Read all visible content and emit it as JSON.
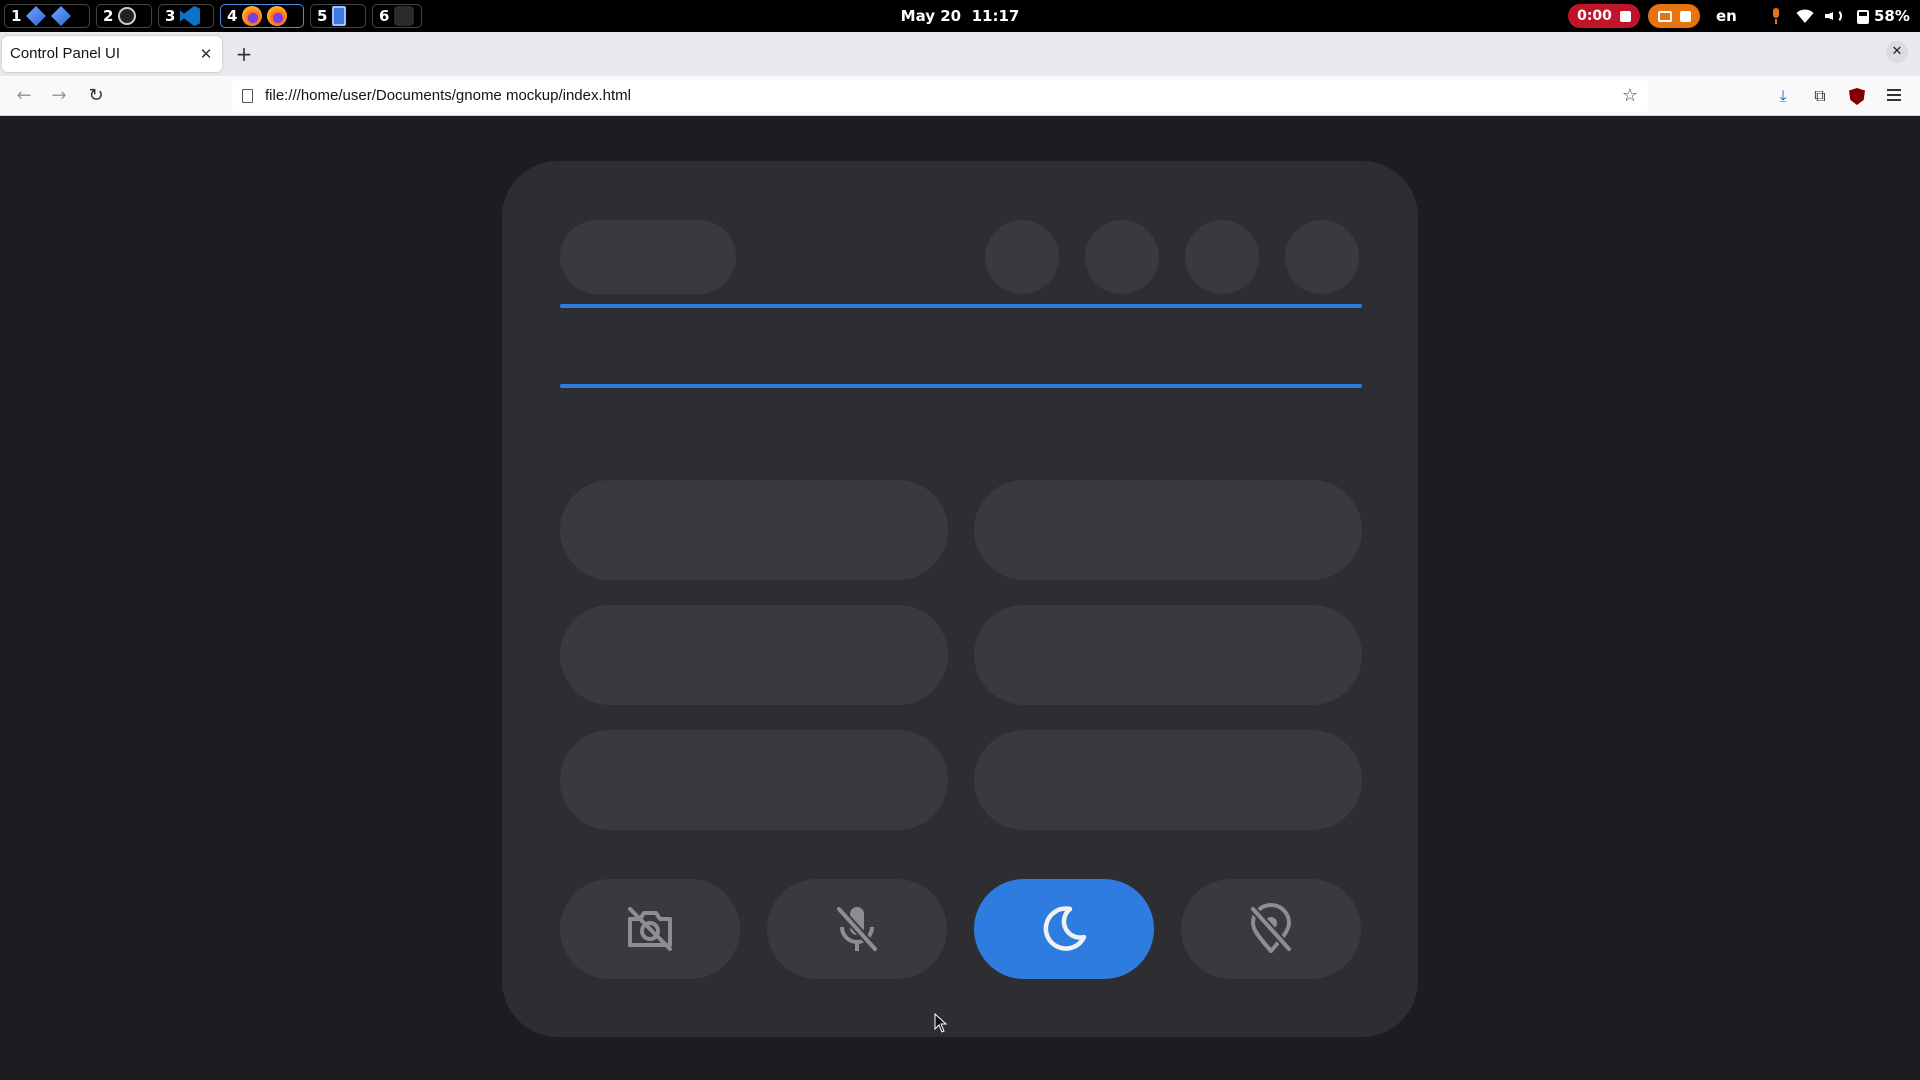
{
  "topbar": {
    "workspaces": [
      {
        "num": "1",
        "apps": [
          "blue-diamond-icon",
          "blue-diamond-icon"
        ]
      },
      {
        "num": "2",
        "apps": [
          "circle-app-icon"
        ]
      },
      {
        "num": "3",
        "apps": [
          "vscode-icon"
        ]
      },
      {
        "num": "4",
        "apps": [
          "firefox-icon",
          "firefox-icon"
        ],
        "active": true
      },
      {
        "num": "5",
        "apps": [
          "document-app-icon"
        ]
      },
      {
        "num": "6",
        "apps": [
          "empty-app-icon"
        ]
      }
    ],
    "date": "May 20",
    "time": "11:17",
    "recording_time": "0:00",
    "language": "en",
    "battery": "58%"
  },
  "browser": {
    "tab_title": "Control Panel UI",
    "url": "file:///home/user/Documents/gnome mockup/index.html"
  },
  "panel": {
    "slider_color": "#2f7ce0",
    "quick_toggles": [
      {
        "name": "camera-off",
        "icon": "camera-off-icon",
        "active": false
      },
      {
        "name": "microphone-off",
        "icon": "microphone-off-icon",
        "active": false
      },
      {
        "name": "do-not-disturb",
        "icon": "moon-icon",
        "active": true
      },
      {
        "name": "location-off",
        "icon": "location-off-icon",
        "active": false
      }
    ]
  },
  "colors": {
    "accent": "#2f7ce0",
    "panel_bg": "#2e2e32",
    "tile_bg": "#3a3a3e",
    "page_bg": "#1d1d21"
  }
}
